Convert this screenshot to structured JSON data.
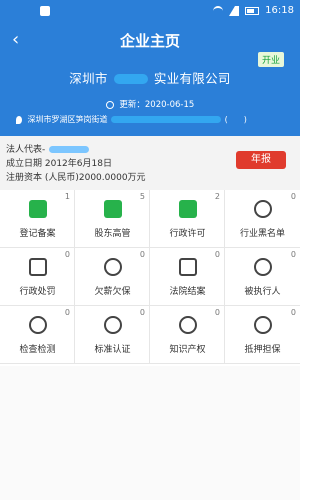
{
  "statusbar": {
    "time": "16:18"
  },
  "header": {
    "back_icon": "chevron-left-icon",
    "title": "企业主页",
    "company_prefix": "深圳市",
    "company_suffix": "实业有限公司",
    "status": "开业",
    "updated": "更新：2020-06-15",
    "address_prefix": "深圳市罗湖区笋岗街道",
    "address_suffix": "(　　)"
  },
  "info": {
    "legal_rep": "法人代表-",
    "founded": "成立日期  2012年6月18日",
    "capital": "注册资本 (人民币)2000.0000万元",
    "annual_report": "年报"
  },
  "grid": [
    {
      "label": "登记备案",
      "count": "1",
      "icon": "edit-document-icon"
    },
    {
      "label": "股东高管",
      "count": "5",
      "icon": "people-icon"
    },
    {
      "label": "行政许可",
      "count": "2",
      "icon": "license-icon"
    },
    {
      "label": "行业黑名单",
      "count": "0",
      "icon": "person-block-icon"
    },
    {
      "label": "行政处罚",
      "count": "0",
      "icon": "document-penalty-icon"
    },
    {
      "label": "欠薪欠保",
      "count": "0",
      "icon": "owe-icon"
    },
    {
      "label": "法院结案",
      "count": "0",
      "icon": "court-icon"
    },
    {
      "label": "被执行人",
      "count": "0",
      "icon": "execute-icon"
    },
    {
      "label": "检查检测",
      "count": "0",
      "icon": "inspect-icon"
    },
    {
      "label": "标准认证",
      "count": "0",
      "icon": "certified-icon"
    },
    {
      "label": "知识产权",
      "count": "0",
      "icon": "ip-icon"
    },
    {
      "label": "抵押担保",
      "count": "0",
      "icon": "mortgage-icon"
    }
  ]
}
